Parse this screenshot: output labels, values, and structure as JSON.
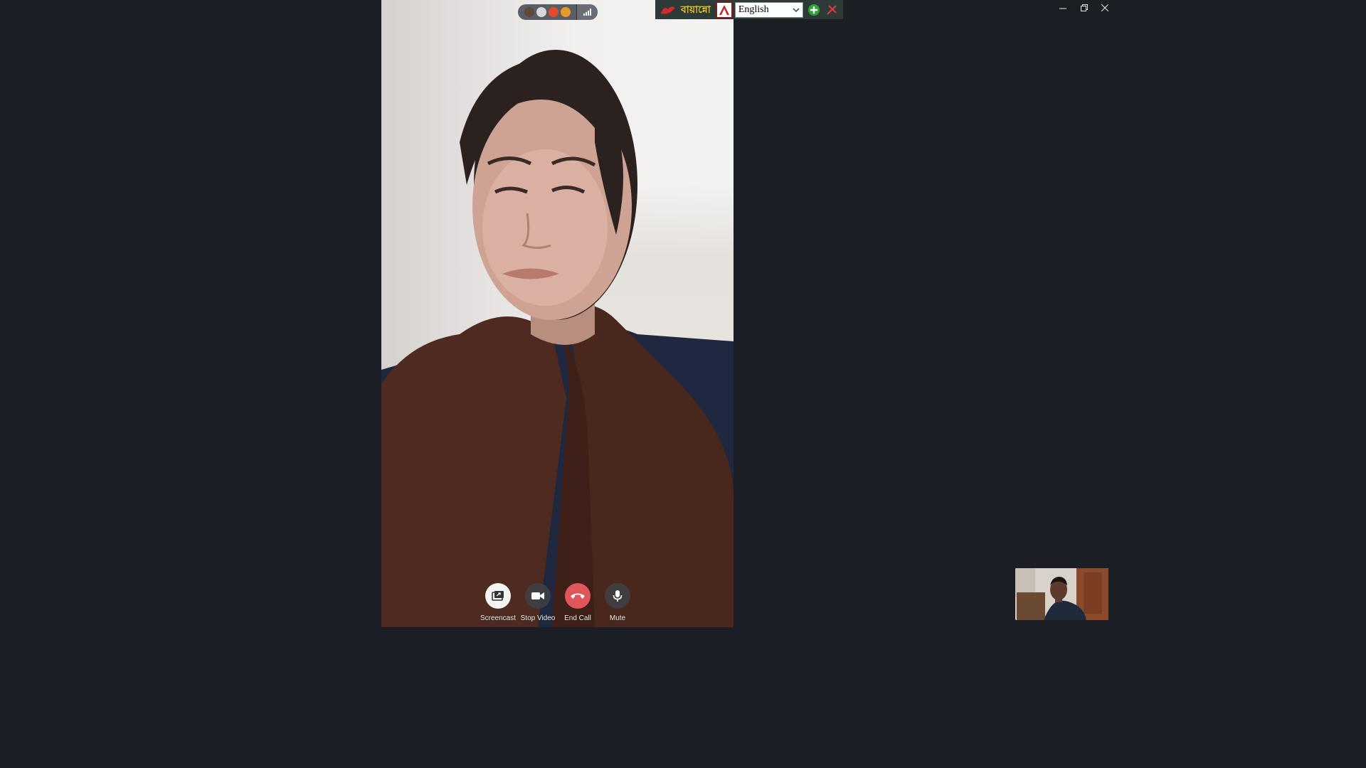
{
  "call": {
    "remote_video": {
      "description_icon": "person-icon"
    },
    "badge": {
      "icons": [
        "monkey-icon",
        "ghost-icon",
        "apple-icon",
        "burger-icon"
      ],
      "signal_icon": "signal-bars-icon"
    }
  },
  "language_bar": {
    "logo_text": "বায়ান্নো",
    "selected_language": "English",
    "icons": [
      "pen-icon",
      "a-glyph-icon",
      "chevron-down-icon",
      "plus-icon",
      "close-tool-icon"
    ]
  },
  "window_controls": {
    "minimize_icon": "minimize-icon",
    "maximize_icon": "restore-icon",
    "close_icon": "close-icon"
  },
  "controls": [
    {
      "label": "Screencast",
      "icon": "screencast-icon"
    },
    {
      "label": "Stop Video",
      "icon": "video-camera-icon"
    },
    {
      "label": "End Call",
      "icon": "phone-hangup-icon"
    },
    {
      "label": "Mute",
      "icon": "microphone-icon"
    }
  ],
  "colors": {
    "background": "#1b1e24",
    "end_call": "#e0565b",
    "lang_logo": "#e8c020"
  }
}
